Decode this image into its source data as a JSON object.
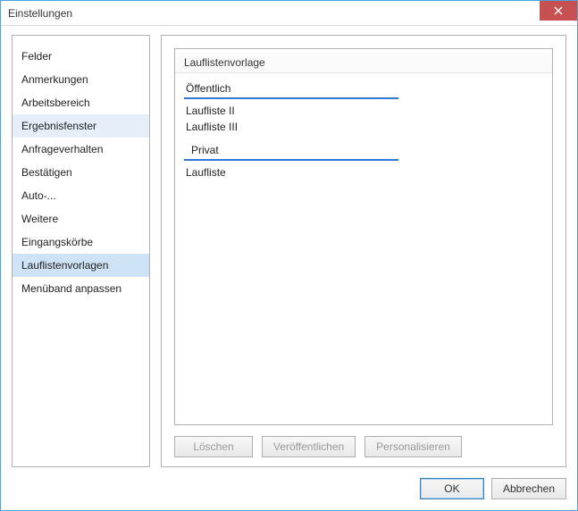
{
  "titlebar": {
    "title": "Einstellungen"
  },
  "sidebar": {
    "items": [
      {
        "label": "Felder"
      },
      {
        "label": "Anmerkungen"
      },
      {
        "label": "Arbeitsbereich"
      },
      {
        "label": "Ergebnisfenster"
      },
      {
        "label": "Anfrageverhalten"
      },
      {
        "label": "Bestätigen"
      },
      {
        "label": "Auto-..."
      },
      {
        "label": "Weitere"
      },
      {
        "label": "Eingangskörbe"
      },
      {
        "label": "Lauflistenvorlagen"
      },
      {
        "label": "Menüband anpassen"
      }
    ]
  },
  "main": {
    "heading": "Lauflistenvorlage",
    "sections": [
      {
        "title": "Öffentlich",
        "items": [
          "Laufliste II",
          "Laufliste III"
        ]
      },
      {
        "title": "Privat",
        "items": [
          "Laufliste"
        ]
      }
    ],
    "buttons": {
      "delete": "Löschen",
      "publish": "Veröffentlichen",
      "personalize": "Personalisieren"
    }
  },
  "footer": {
    "ok": "OK",
    "cancel": "Abbrechen"
  }
}
